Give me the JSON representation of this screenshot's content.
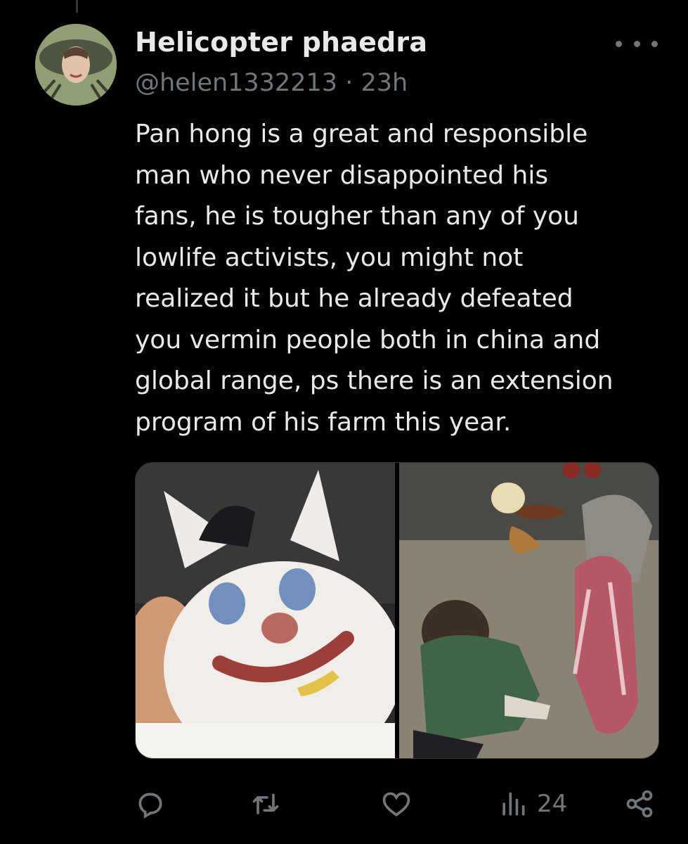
{
  "tweet": {
    "display_name": "Helicopter phaedra",
    "handle": "@helen1332213",
    "separator": "·",
    "time": "23h",
    "text_lines": [
      "Pan hong is a great and responsible",
      "man who never disappointed his",
      "fans, he is tougher than any of you",
      "lowlife activists, you might not",
      "realized it but he already defeated",
      "you vermin people both in china and",
      "global range, ps there is an extension",
      "program of his farm this year."
    ]
  },
  "actions": {
    "views_count": "24"
  },
  "icons": {
    "more": "more-icon",
    "reply": "reply-icon",
    "retweet": "retweet-icon",
    "like": "like-icon",
    "views": "views-icon",
    "share": "share-icon"
  },
  "colors": {
    "background": "#000000",
    "text_primary": "#e7e9ea",
    "text_secondary": "#71767b",
    "border": "#2f3336"
  }
}
